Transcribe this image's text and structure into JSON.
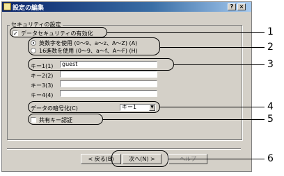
{
  "window": {
    "title": "設定の編集",
    "help_btn": "?",
    "close_btn": "×"
  },
  "security": {
    "group_title": "セキュリティの設定",
    "enable_label": "データセキュリティの有効化",
    "enable_checked": true,
    "radio_alnum": "英数字を使用 (0〜9、a〜z、A〜Z) (A)",
    "radio_hex": "16進数を使用 (0〜9、a〜f、A〜F) (H)",
    "keys": [
      {
        "label": "キー1(1)",
        "value": "guest"
      },
      {
        "label": "キー2(2)",
        "value": ""
      },
      {
        "label": "キー3(3)",
        "value": ""
      },
      {
        "label": "キー4(4)",
        "value": ""
      }
    ],
    "encrypt_label": "データの暗号化(C)",
    "encrypt_value": "キー1",
    "shared_key_label": "共有キー認証",
    "shared_key_checked": false
  },
  "buttons": {
    "back": "< 戻る(B)",
    "next": "次へ(N) >",
    "help": "ヘルプ"
  },
  "callouts": [
    "1",
    "2",
    "3",
    "4",
    "5",
    "6"
  ]
}
